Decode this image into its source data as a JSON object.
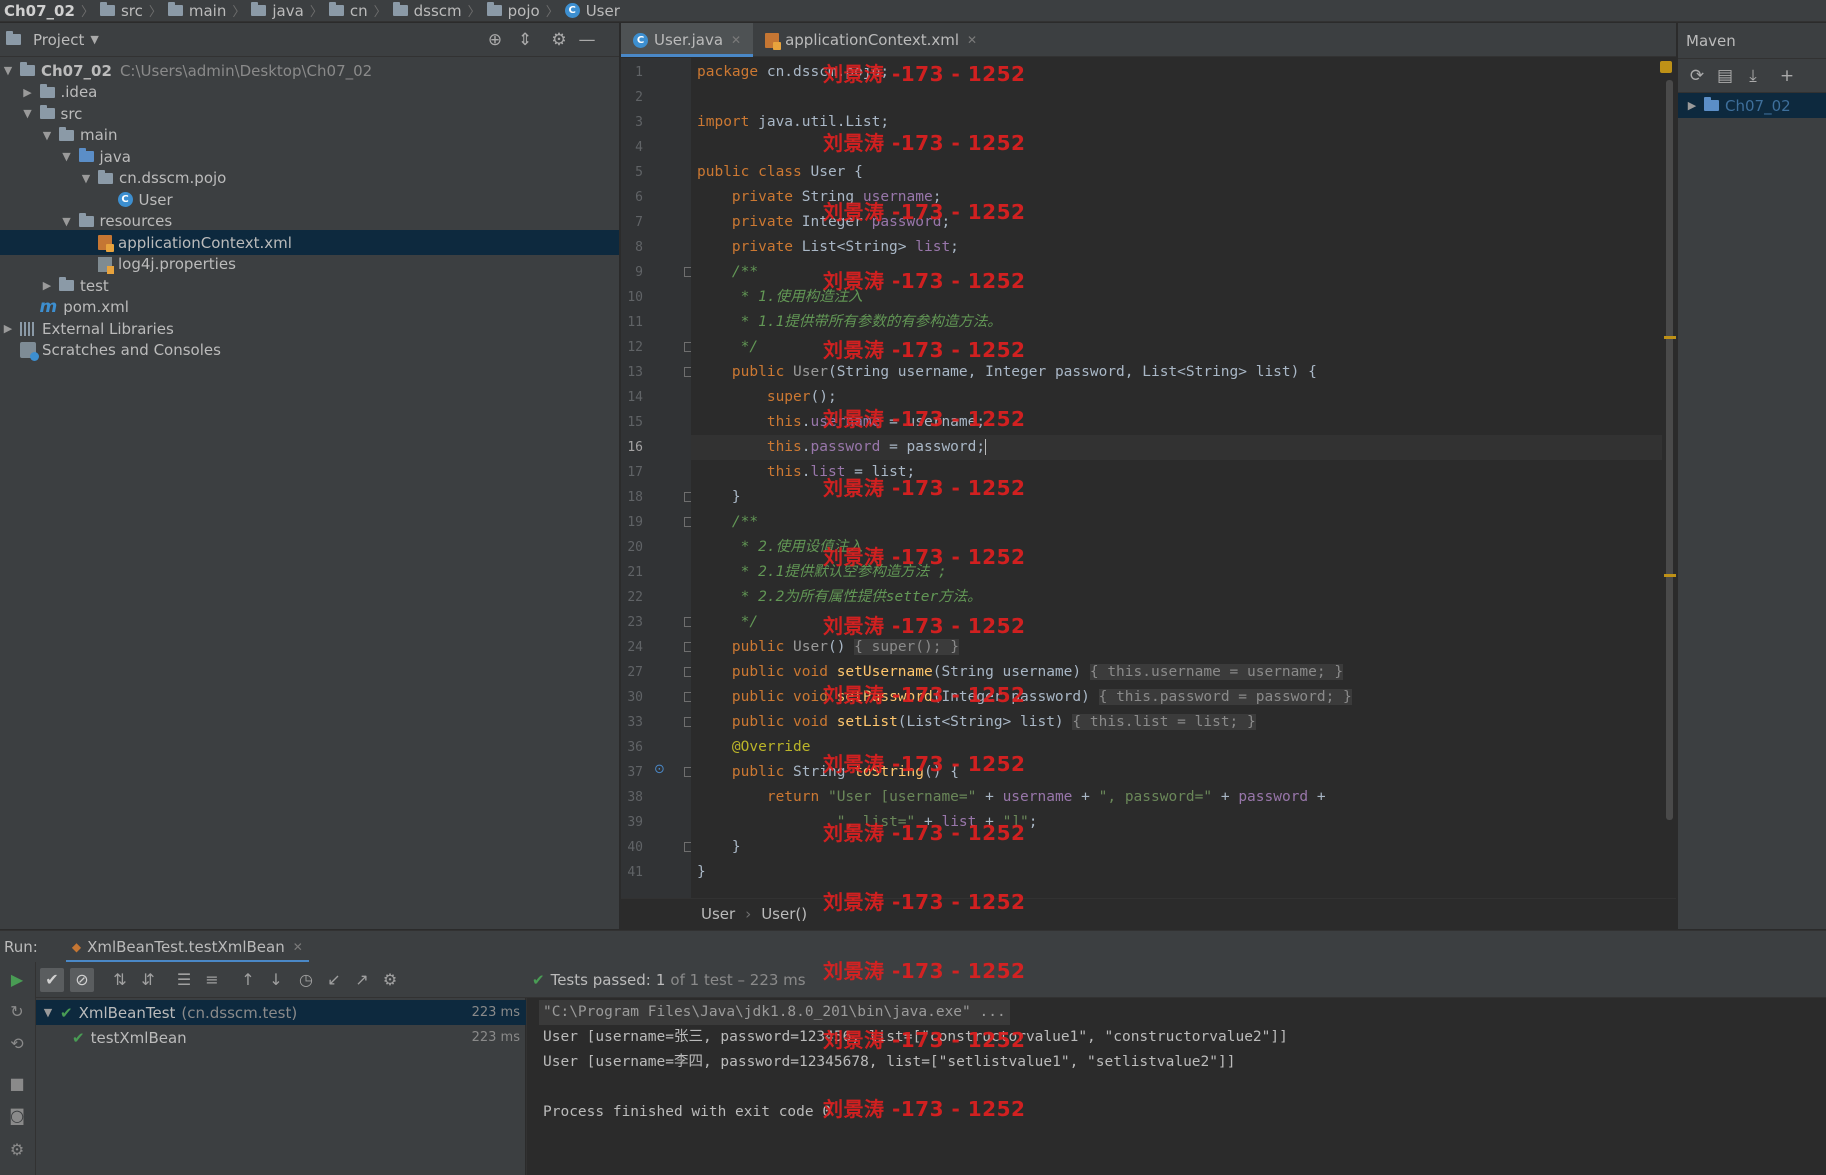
{
  "breadcrumb": [
    "Ch07_02",
    "src",
    "main",
    "java",
    "cn",
    "dsscm",
    "pojo",
    "User"
  ],
  "project_panel": {
    "title": "Project",
    "tree": [
      {
        "label": "Ch07_02",
        "extra": "C:\\Users\\admin\\Desktop\\Ch07_02",
        "icon": "module-folder-icon",
        "arrow": "down",
        "indent": 0
      },
      {
        "label": ".idea",
        "icon": "folder-icon",
        "arrow": "right",
        "indent": 1
      },
      {
        "label": "src",
        "icon": "folder-icon",
        "arrow": "down",
        "indent": 1
      },
      {
        "label": "main",
        "icon": "folder-icon",
        "arrow": "down",
        "indent": 2
      },
      {
        "label": "java",
        "icon": "source-folder-icon",
        "arrow": "down",
        "indent": 3
      },
      {
        "label": "cn.dsscm.pojo",
        "icon": "package-icon",
        "arrow": "down",
        "indent": 4
      },
      {
        "label": "User",
        "icon": "class-icon",
        "arrow": "",
        "indent": 5
      },
      {
        "label": "resources",
        "icon": "resources-folder-icon",
        "arrow": "down",
        "indent": 3
      },
      {
        "label": "applicationContext.xml",
        "icon": "xml-file-icon",
        "arrow": "",
        "indent": 4,
        "selected": true
      },
      {
        "label": "log4j.properties",
        "icon": "properties-file-icon",
        "arrow": "",
        "indent": 4
      },
      {
        "label": "test",
        "icon": "folder-icon",
        "arrow": "right",
        "indent": 2
      },
      {
        "label": "pom.xml",
        "icon": "maven-file-icon",
        "arrow": "",
        "indent": 1
      },
      {
        "label": "External Libraries",
        "icon": "libraries-icon",
        "arrow": "right",
        "indent": 0
      },
      {
        "label": "Scratches and Consoles",
        "icon": "scratches-icon",
        "arrow": "",
        "indent": 0
      }
    ]
  },
  "editor": {
    "tabs": [
      {
        "label": "User.java",
        "active": true,
        "icon": "class-icon"
      },
      {
        "label": "applicationContext.xml",
        "active": false,
        "icon": "xml-file-icon"
      }
    ],
    "current_line": "16",
    "lines": [
      {
        "n": "1",
        "html": "<span class=\"kw\">package</span> cn.dsscm.pojo;"
      },
      {
        "n": "2",
        "html": ""
      },
      {
        "n": "3",
        "html": "<span class=\"kw\">import</span> java.util.List;"
      },
      {
        "n": "4",
        "html": ""
      },
      {
        "n": "5",
        "html": "<span class=\"kw\">public class</span> User {"
      },
      {
        "n": "6",
        "html": "    <span class=\"kw\">private</span> String <span class=\"fld\">username</span>;"
      },
      {
        "n": "7",
        "html": "    <span class=\"kw\">private</span> Integer <span class=\"fld\">password</span>;"
      },
      {
        "n": "8",
        "html": "    <span class=\"kw\">private</span> List&lt;String&gt; <span class=\"fld\">list</span>;"
      },
      {
        "n": "9",
        "html": "    <span class=\"cm\">/**</span>"
      },
      {
        "n": "10",
        "html": "<span class=\"cm\">     * 1.使用构造注入</span>"
      },
      {
        "n": "11",
        "html": "<span class=\"cm\">     * 1.1提供带所有参数的有参构造方法。</span>"
      },
      {
        "n": "12",
        "html": "<span class=\"cm\">     */</span>"
      },
      {
        "n": "13",
        "html": "    <span class=\"kw\">public</span> <span class=\"dim\">User</span>(String username, Integer password, List&lt;String&gt; list) {"
      },
      {
        "n": "14",
        "html": "        <span class=\"kw\">super</span>();"
      },
      {
        "n": "15",
        "html": "        <span class=\"kw\">this</span>.<span class=\"fld\">username</span> = username;"
      },
      {
        "n": "16",
        "html": "        <span class=\"kw\">this</span>.<span class=\"fld\">password</span> = password;<span style=\"border-left:1px solid #bbb;\"></span>"
      },
      {
        "n": "17",
        "html": "        <span class=\"kw\">this</span>.<span class=\"fld\">list</span> = list;"
      },
      {
        "n": "18",
        "html": "    }"
      },
      {
        "n": "19",
        "html": "    <span class=\"cm\">/**</span>"
      },
      {
        "n": "20",
        "html": "<span class=\"cm\">     * 2.使用设值注入</span>"
      },
      {
        "n": "21",
        "html": "<span class=\"cm\">     * 2.1提供默认空参构造方法 ;</span>"
      },
      {
        "n": "22",
        "html": "<span class=\"cm\">     * 2.2为所有属性提供setter方法。</span>"
      },
      {
        "n": "23",
        "html": "<span class=\"cm\">     */</span>"
      },
      {
        "n": "24",
        "html": "    <span class=\"kw\">public</span> <span class=\"dim\">User</span>() <span class=\"fb\">{ </span><span class=\"kw fb\">super</span><span class=\"fb\">(); }</span>"
      },
      {
        "n": "27",
        "html": "    <span class=\"kw\">public void</span> <span class=\"fn\">setUsername</span>(String username) <span class=\"fb\">{ </span><span class=\"kw fb\">this</span><span class=\"fb\">.</span><span class=\"fld fb\">username</span><span class=\"fb\"> = username; }</span>"
      },
      {
        "n": "30",
        "html": "    <span class=\"kw\">public void</span> <span class=\"fn\">setPassword</span>(Integer password) <span class=\"fb\">{ </span><span class=\"kw fb\">this</span><span class=\"fb\">.</span><span class=\"fld fb\">password</span><span class=\"fb\"> = password; }</span>"
      },
      {
        "n": "33",
        "html": "    <span class=\"kw\">public void</span> <span class=\"fn\">setList</span>(List&lt;String&gt; list) <span class=\"fb\">{ </span><span class=\"kw fb\">this</span><span class=\"fb\">.</span><span class=\"fld fb\">list</span><span class=\"fb\"> = list; }</span>"
      },
      {
        "n": "36",
        "html": "    <span class=\"ann\">@Override</span>"
      },
      {
        "n": "37",
        "html": "    <span class=\"kw\">public</span> String <span class=\"fn\">toString</span>() {"
      },
      {
        "n": "38",
        "html": "        <span class=\"kw\">return</span> <span class=\"str\">\"User [username=\"</span> + <span class=\"fld\">username</span> + <span class=\"str\">\", password=\"</span> + <span class=\"fld\">password</span> +"
      },
      {
        "n": "39",
        "html": "                <span class=\"str\">\", list=\"</span> + <span class=\"fld\">list</span> + <span class=\"str\">\"]\"</span>;"
      },
      {
        "n": "40",
        "html": "    }"
      },
      {
        "n": "41",
        "html": "}"
      }
    ],
    "folds_at": [
      "9",
      "12",
      "13",
      "18",
      "19",
      "23",
      "24",
      "27",
      "30",
      "33",
      "37",
      "40"
    ],
    "watermark": "刘景涛 -173 - 1252",
    "footer_crumb": [
      "User",
      "User()"
    ]
  },
  "maven": {
    "title": "Maven",
    "project": "Ch07_02"
  },
  "run": {
    "label": "Run:",
    "tab": "XmlBeanTest.testXmlBean",
    "status_prefix": "Tests passed:",
    "status_count": "1",
    "status_suffix": "of 1 test – 223 ms",
    "tree": [
      {
        "name": "XmlBeanTest",
        "pkg": "(cn.dsscm.test)",
        "ms": "223 ms",
        "selected": true,
        "arrow": "down"
      },
      {
        "name": "testXmlBean",
        "pkg": "",
        "ms": "223 ms",
        "selected": false,
        "arrow": ""
      }
    ],
    "console": [
      "\"C:\\Program Files\\Java\\jdk1.8.0_201\\bin\\java.exe\" ...",
      "User [username=张三, password=123456, list=[\"constructorvalue1\", \"constructorvalue2\"]]",
      "User [username=李四, password=12345678, list=[\"setlistvalue1\", \"setlistvalue2\"]]",
      "",
      "Process finished with exit code 0"
    ]
  },
  "colors": {
    "accent": "#4a88c7",
    "selection": "#0d293e",
    "watermark": "#e02020",
    "pass": "#499c54"
  }
}
